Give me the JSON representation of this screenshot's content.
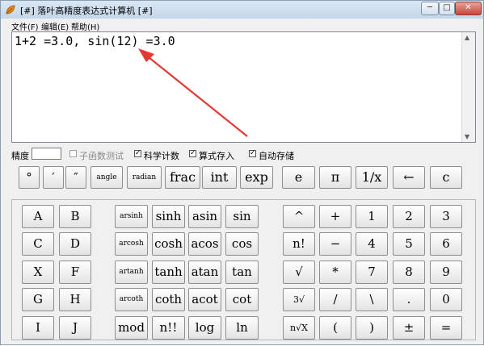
{
  "window": {
    "title": "[#] 落叶高精度表达式计算机 [#]",
    "controls": {
      "minimize": "─",
      "maximize": "□",
      "close": "✕"
    }
  },
  "menu": [
    "文件(F)",
    "编辑(E)",
    "帮助(H)"
  ],
  "display": {
    "expression": "1+2 =3.0, sin(12) =3.0"
  },
  "options": {
    "precision_label": "精度",
    "precision_value": "",
    "subfunc_test": {
      "label": "子函数测试",
      "checked": false,
      "enabled": false
    },
    "sci_notation": {
      "label": "科学计数",
      "checked": true
    },
    "store_formula": {
      "label": "算式存入",
      "checked": true
    },
    "auto_store": {
      "label": "自动存储",
      "checked": true
    }
  },
  "top_row": [
    "°",
    "′",
    "″",
    "angle",
    "radian",
    "frac",
    "int",
    "exp",
    "e",
    "π",
    "1/x",
    "←",
    "c"
  ],
  "letters": [
    "A",
    "B",
    "C",
    "D",
    "X",
    "F",
    "G",
    "H",
    "I",
    "J"
  ],
  "hyperbolic": [
    "arsinh",
    "arcosh",
    "artanh",
    "arcoth",
    "mod"
  ],
  "trig": [
    [
      "sinh",
      "asin",
      "sin"
    ],
    [
      "cosh",
      "acos",
      "cos"
    ],
    [
      "tanh",
      "atan",
      "tan"
    ],
    [
      "coth",
      "acot",
      "cot"
    ],
    [
      "n!!",
      "log",
      "ln"
    ]
  ],
  "ops": [
    "^",
    "n!",
    "√",
    "3√",
    "n√X"
  ],
  "ops2": [
    "+",
    "−",
    "*",
    "/",
    "("
  ],
  "digits": [
    [
      "1",
      "2",
      "3"
    ],
    [
      "4",
      "5",
      "6"
    ],
    [
      "7",
      "8",
      "9"
    ],
    [
      "\\",
      ".",
      "0"
    ],
    [
      ")",
      "±",
      "="
    ]
  ],
  "accent_color": "#e53935"
}
